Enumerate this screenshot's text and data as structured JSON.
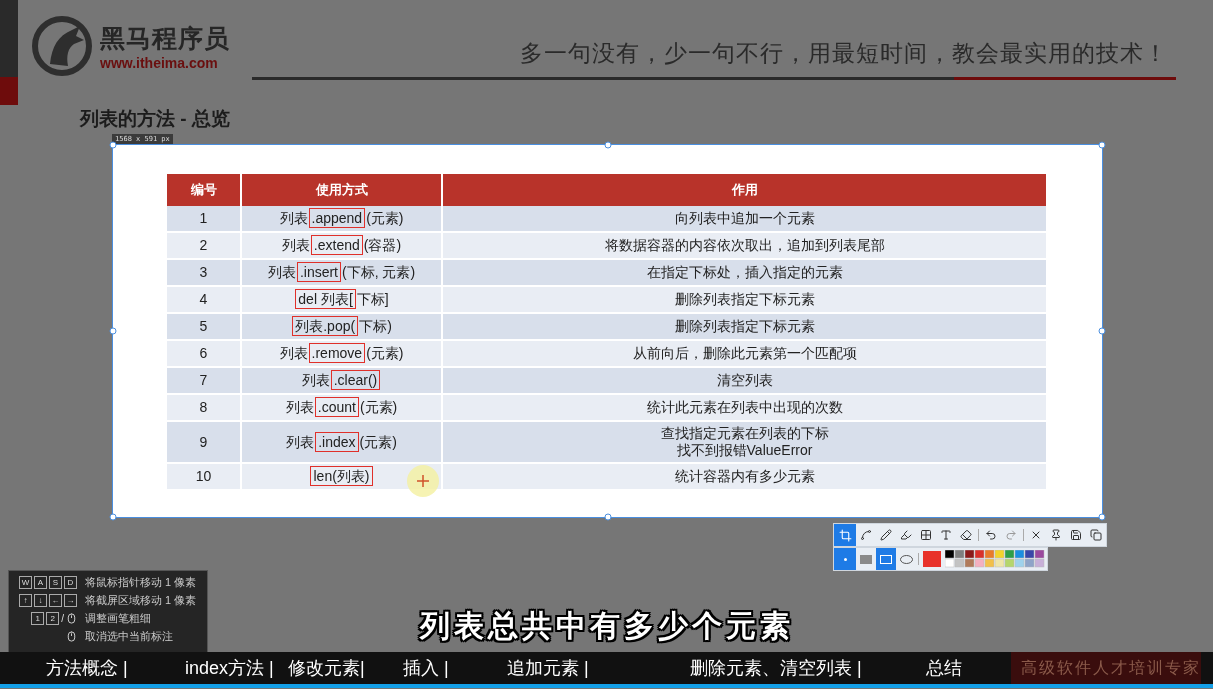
{
  "header": {
    "logo_name": "黑马程序员",
    "logo_url": "www.itheima.com",
    "slogan": "多一句没有，少一句不行，用最短时间，教会最实用的技术！"
  },
  "title": "列表的方法 - 总览",
  "selection": {
    "size_label": "1568 x 591  px"
  },
  "table": {
    "columns": [
      "编号",
      "使用方式",
      "作用"
    ],
    "rows": [
      {
        "number": "1",
        "usage": {
          "before": "列表",
          "boxed": ".append",
          "after": "(元素)"
        },
        "effect": [
          "向列表中追加一个元素"
        ]
      },
      {
        "number": "2",
        "usage": {
          "before": "列表",
          "boxed": ".extend",
          "after": "(容器)"
        },
        "effect": [
          "将数据容器的内容依次取出，追加到列表尾部"
        ]
      },
      {
        "number": "3",
        "usage": {
          "before": "列表",
          "boxed": ".insert",
          "after": "(下标, 元素)"
        },
        "effect": [
          "在指定下标处，插入指定的元素"
        ]
      },
      {
        "number": "4",
        "usage": {
          "boxed": "del 列表[",
          "after": "下标]"
        },
        "effect": [
          "删除列表指定下标元素"
        ]
      },
      {
        "number": "5",
        "usage": {
          "boxed": "列表.pop(",
          "after": "下标)"
        },
        "effect": [
          "删除列表指定下标元素"
        ]
      },
      {
        "number": "6",
        "usage": {
          "before": "列表",
          "boxed": ".remove",
          "after": "(元素)"
        },
        "effect": [
          "从前向后，删除此元素第一个匹配项"
        ]
      },
      {
        "number": "7",
        "usage": {
          "before": "列表",
          "boxed": ".clear()"
        },
        "effect": [
          "清空列表"
        ]
      },
      {
        "number": "8",
        "usage": {
          "before": "列表",
          "boxed": ".count",
          "after": "(元素)"
        },
        "effect": [
          "统计此元素在列表中出现的次数"
        ]
      },
      {
        "number": "9",
        "usage": {
          "before": "列表",
          "boxed": ".index",
          "after": "(元素)"
        },
        "effect": [
          "查找指定元素在列表的下标",
          "找不到报错ValueError"
        ]
      },
      {
        "number": "10",
        "usage": {
          "boxed": "len(列表)"
        },
        "effect": [
          "统计容器内有多少元素"
        ]
      }
    ]
  },
  "shortcuts": [
    {
      "kind": "keys",
      "keys": [
        "W",
        "A",
        "S",
        "D"
      ],
      "label": "将鼠标指针移动 1 像素"
    },
    {
      "kind": "keys",
      "keys": [
        "↑",
        "↓",
        "←",
        "→"
      ],
      "label": "将截屏区域移动 1 像素"
    },
    {
      "kind": "keys-mouse",
      "keys": [
        "1",
        "2"
      ],
      "separator": "/",
      "label": "调整画笔粗细"
    },
    {
      "kind": "mouse",
      "label": "取消选中当前标注"
    }
  ],
  "subtitle": "列表总共中有多少个元素",
  "chapters": [
    "方法概念 |",
    "index方法 |",
    "修改元素|",
    "插入 |",
    "追加元素 |",
    "删除元素、清空列表 |",
    "总结"
  ],
  "footer_tagline": "高级软件人才培训专家"
}
